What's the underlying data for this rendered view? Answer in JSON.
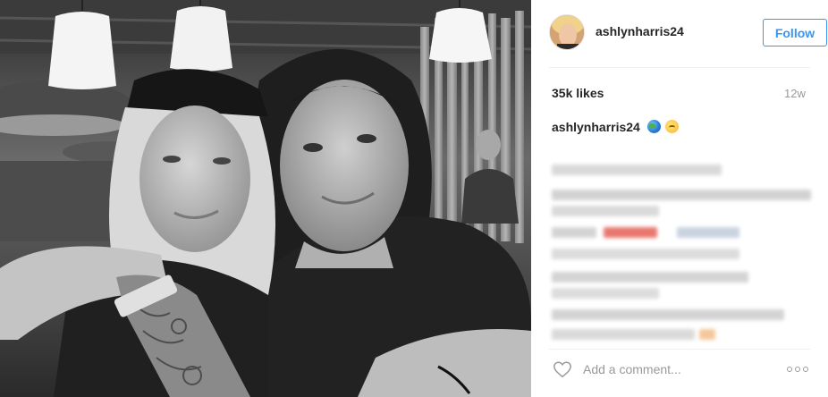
{
  "post": {
    "image_alt": "Black-and-white photo of two women smiling together in a restaurant",
    "username": "ashlynharris24",
    "follow_label": "Follow",
    "likes": "35k likes",
    "time_ago": "12w",
    "caption": {
      "username": "ashlynharris24",
      "emojis": [
        "globe-emoji",
        "upside-down-face-emoji"
      ],
      "text_obscured": true
    },
    "comment_placeholder": "Add a comment...",
    "icons": [
      "heart-icon",
      "more-options-icon"
    ]
  },
  "colors": {
    "accent": "#3897f0",
    "text": "#262626",
    "muted": "#999999",
    "divider": "#efefef"
  }
}
